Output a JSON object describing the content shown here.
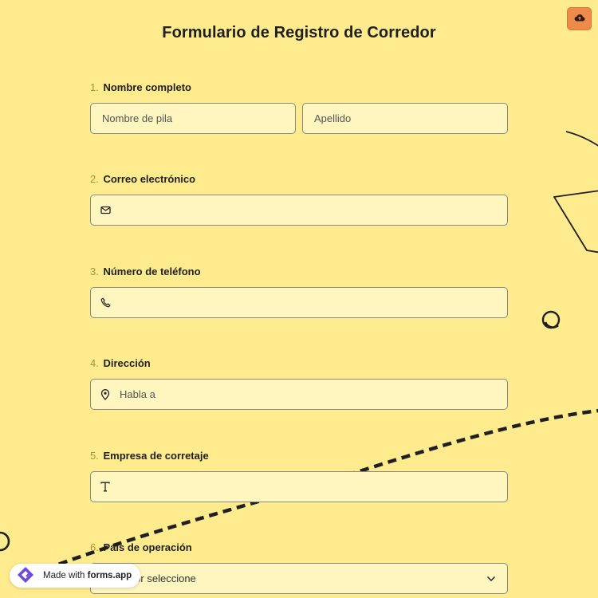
{
  "form": {
    "title": "Formulario de Registro de Corredor",
    "questions": [
      {
        "number": "1.",
        "label": "Nombre completo",
        "first_placeholder": "Nombre de pila",
        "last_placeholder": "Apellido"
      },
      {
        "number": "2.",
        "label": "Correo electrónico",
        "icon": "mail-icon",
        "placeholder": ""
      },
      {
        "number": "3.",
        "label": "Número de teléfono",
        "icon": "phone-icon",
        "placeholder": ""
      },
      {
        "number": "4.",
        "label": "Dirección",
        "icon": "location-pin-icon",
        "placeholder": "Habla a"
      },
      {
        "number": "5.",
        "label": "Empresa de corretaje",
        "icon": "text-icon",
        "placeholder": ""
      },
      {
        "number": "6.",
        "label": "País de operación",
        "select_placeholder": "Por favor seleccione"
      }
    ]
  },
  "save_button": {
    "icon": "cloud-upload-icon",
    "color": "#ee8a4a"
  },
  "badge": {
    "prefix": "Made with ",
    "brand": "forms.app",
    "icon": "forms-app-logo-icon"
  },
  "colors": {
    "background": "#fdeb8d",
    "field_background": "#fff5bf",
    "number": "#a9923b"
  }
}
